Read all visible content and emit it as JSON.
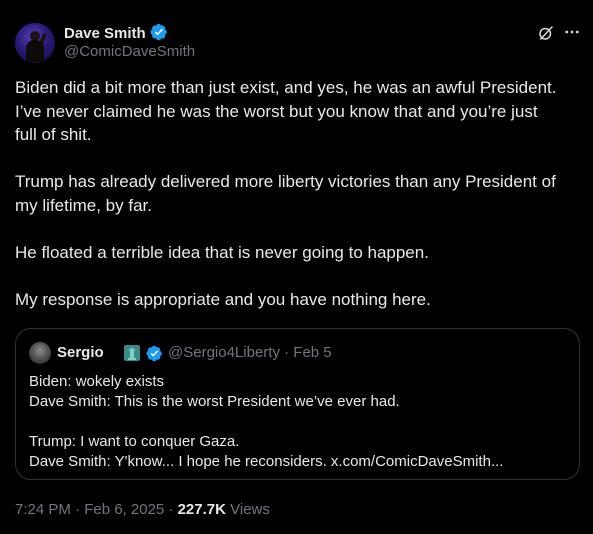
{
  "author": {
    "display_name": "Dave Smith",
    "handle": "@ComicDaveSmith",
    "verified": true
  },
  "tweet": {
    "paragraphs": [
      [
        "Biden did a bit more than just exist, and yes, he was an awful President.",
        "I’ve never claimed he was the worst but you know that and you’re just",
        "full of shit."
      ],
      [
        "Trump has already delivered more liberty victories than any President of",
        "my lifetime, by far."
      ],
      [
        "He floated a terrible idea that is never going to happen."
      ],
      [
        "My response is appropriate and you have nothing here."
      ]
    ]
  },
  "quoted_tweet": {
    "display_name": "Sergio",
    "handle_date": "@Sergio4Liberty · Feb 5",
    "lines": [
      "Biden: wokely exists",
      "Dave Smith: This is the worst President we’ve ever had.",
      "",
      "Trump: I want to conquer Gaza.",
      "Dave Smith: Y'know... I hope he reconsiders. x.com/ComicDaveSmith..."
    ]
  },
  "meta": {
    "timestamp": "7:24 PM · Feb 6, 2025 · ",
    "views_count": "227.7K",
    "views_label": " Views"
  },
  "colors": {
    "background": "#000000",
    "text": "#e7e9ea",
    "muted": "#71767b",
    "verified": "#1d9bf0",
    "border": "#2f3336"
  },
  "icons": [
    "verified-badge-icon",
    "grok-icon",
    "more-options-icon",
    "statue-emoji-icon"
  ]
}
